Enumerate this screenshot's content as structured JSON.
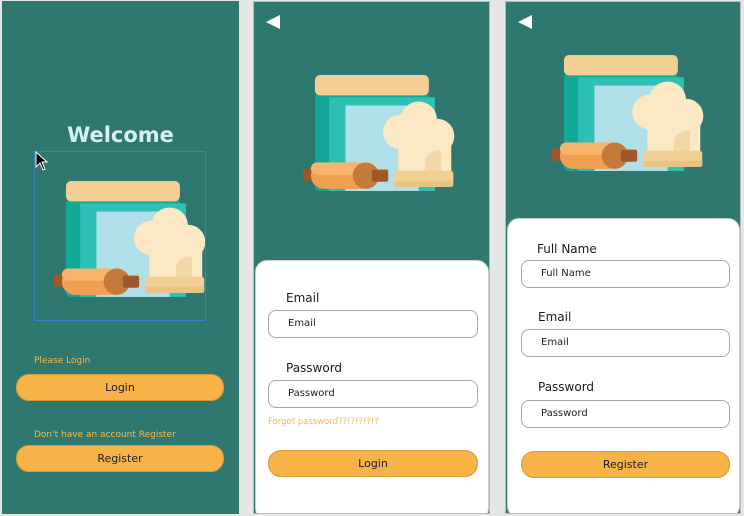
{
  "welcome_screen": {
    "title": "Welcome",
    "login_prompt": "Please Login",
    "login_button": "Login",
    "register_prompt": "Don't have an account Register",
    "register_button": "Register"
  },
  "login_screen": {
    "email_label": "Email",
    "email_placeholder": "Email",
    "password_label": "Password",
    "password_placeholder": "Password",
    "forgot_link": "Forgot password??!?!?!?!?",
    "login_button": "Login"
  },
  "register_screen": {
    "fullname_label": "Full Name",
    "fullname_placeholder": "Full Name",
    "email_label": "Email",
    "email_placeholder": "Email",
    "password_label": "Password",
    "password_placeholder": "Password",
    "register_button": "Register"
  },
  "icons": {
    "back": "back-arrow-icon",
    "illustration": "cookbook-chef-hat-rolling-pin-illustration",
    "cursor": "mouse-cursor-icon"
  },
  "colors": {
    "background": "#2e7870",
    "accent": "#f7b347",
    "title_text": "#d6f1ef",
    "link_text": "#f2b84b"
  }
}
